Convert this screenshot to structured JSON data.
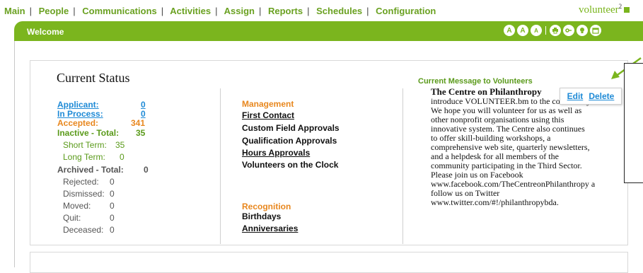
{
  "nav": {
    "items": [
      "Main",
      "People",
      "Communications",
      "Activities",
      "Assign",
      "Reports",
      "Schedules",
      "Configuration"
    ],
    "logo_text": "volunteer",
    "logo_sup": "2"
  },
  "header": {
    "welcome": "Welcome",
    "text_sizes": [
      "A",
      "A",
      "A"
    ]
  },
  "status": {
    "title": "Current Status",
    "applicant_label": "Applicant:",
    "applicant_value": "0",
    "inprocess_label": "In Process:",
    "inprocess_value": "0",
    "accepted_label": "Accepted:",
    "accepted_value": "341",
    "inactive_label": "Inactive - Total:",
    "inactive_value": "35",
    "short_term_label": "Short Term:",
    "short_term_value": "35",
    "long_term_label": "Long Term:",
    "long_term_value": "0",
    "archived_label": "Archived - Total:",
    "archived_value": "0",
    "rejected_label": "Rejected:",
    "rejected_value": "0",
    "dismissed_label": "Dismissed:",
    "dismissed_value": "0",
    "moved_label": "Moved:",
    "moved_value": "0",
    "quit_label": "Quit:",
    "quit_value": "0",
    "deceased_label": "Deceased:",
    "deceased_value": "0"
  },
  "management": {
    "heading": "Management",
    "first_contact": "First Contact",
    "custom_field": "Custom Field Approvals",
    "qualification": "Qualification Approvals",
    "hours": "Hours Approvals",
    "on_clock": "Volunteers on the Clock"
  },
  "recognition": {
    "heading": "Recognition",
    "birthdays": "Birthdays",
    "anniversaries": "Anniversaries"
  },
  "message": {
    "title": "Current Message to Volunteers",
    "org_name": "The Centre on Philanthropy",
    "line1": "introduce VOLUNTEER.bm to the community.",
    "line2": "We hope you will volunteer for us as well as",
    "line3": "other nonprofit organisations using this",
    "line4": "innovative system. The Centre also continues",
    "line5": "to offer skill-building workshops, a",
    "line6": "comprehensive web site, quarterly newsletters,",
    "line7": "and a helpdesk for all members of the",
    "line8": "community participating in the Third Sector.",
    "line9": "Please join us on Facebook",
    "line10": "www.facebook.com/TheCentreonPhilanthropy a",
    "line11": "follow us on Twitter",
    "line12": "www.twitter.com/#!/philanthropybda.",
    "edit_label": "Edit",
    "delete_label": "Delete"
  },
  "colors": {
    "accent_green": "#7bb51e",
    "link_blue": "#1e8ad6",
    "orange": "#e8871e"
  }
}
